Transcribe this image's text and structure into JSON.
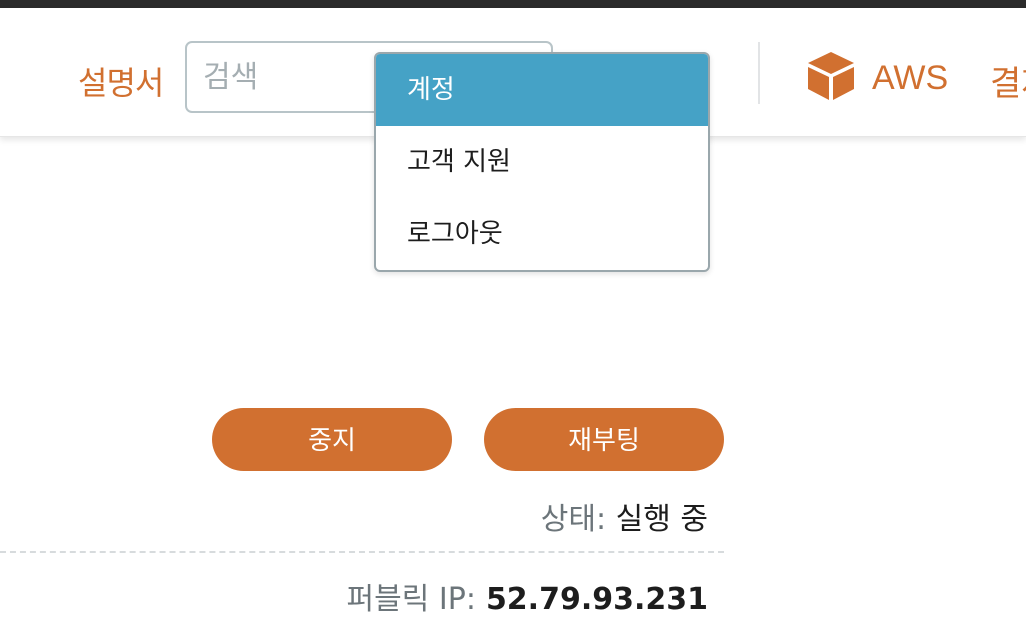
{
  "header": {
    "docs_label": "설명서",
    "search": {
      "placeholder": "검색",
      "value": ""
    },
    "aws": {
      "icon": "cube-icon",
      "label": "AWS"
    },
    "billing_partial": "결제"
  },
  "account_menu": {
    "items": [
      {
        "label": "계정",
        "highlighted": true
      },
      {
        "label": "고객 지원",
        "highlighted": false
      },
      {
        "label": "로그아웃",
        "highlighted": false
      }
    ]
  },
  "instance": {
    "stop_label": "중지",
    "reboot_label": "재부팅",
    "status_label": "상태:",
    "status_value": "실행 중",
    "public_ip_label": "퍼블릭 IP:",
    "public_ip_value": "52.79.93.231"
  },
  "colors": {
    "brand_orange": "#d17030",
    "menu_highlight": "#45a2c6",
    "top_bar": "#2b2b2b"
  }
}
